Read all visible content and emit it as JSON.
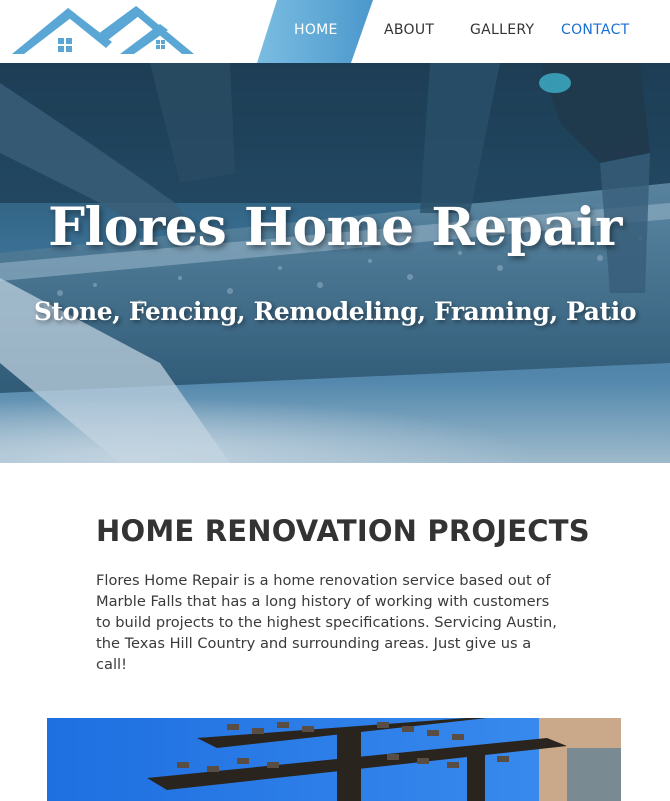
{
  "nav": {
    "items": [
      {
        "label": "HOME"
      },
      {
        "label": "ABOUT"
      },
      {
        "label": "GALLERY"
      },
      {
        "label": "CONTACT"
      }
    ],
    "active": "HOME"
  },
  "hero": {
    "title": "Flores Home Repair",
    "subtitle": "Stone, Fencing, Remodeling, Framing, Patio"
  },
  "about": {
    "heading": "HOME RENOVATION PROJECTS",
    "body": "Flores Home Repair is a home renovation service based out of Marble Falls that has a long history of working with customers to build projects to the highest specifications. Servicing Austin, the Texas Hill Country and surrounding areas. Just give us a call!"
  },
  "icons": {
    "logo": "house-roof-logo"
  },
  "colors": {
    "accent": "#5aa7d6",
    "contact_link": "#1a6fd4",
    "text": "#333333",
    "hero_tint": "#2e6f9e"
  }
}
